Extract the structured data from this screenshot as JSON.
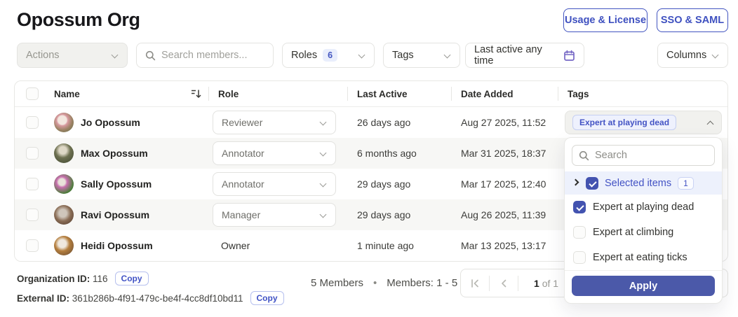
{
  "header": {
    "title": "Opossum Org",
    "usage_button": "Usage & License",
    "sso_button": "SSO & SAML"
  },
  "toolbar": {
    "actions_label": "Actions",
    "search_placeholder": "Search members...",
    "roles_label": "Roles",
    "roles_count": "6",
    "tags_label": "Tags",
    "last_active_label": "Last active any time",
    "columns_label": "Columns"
  },
  "table": {
    "columns": [
      "Name",
      "Role",
      "Last Active",
      "Date Added",
      "Tags"
    ],
    "rows": [
      {
        "name": "Jo Opossum",
        "role": "Reviewer",
        "last_active": "26 days ago",
        "date_added": "Aug 27 2025, 11:52",
        "tag": "Expert at playing dead"
      },
      {
        "name": "Max Opossum",
        "role": "Annotator",
        "last_active": "6 months ago",
        "date_added": "Mar 31 2025, 18:37",
        "tag": ""
      },
      {
        "name": "Sally Opossum",
        "role": "Annotator",
        "last_active": "29 days ago",
        "date_added": "Mar 17 2025, 12:40",
        "tag": ""
      },
      {
        "name": "Ravi Opossum",
        "role": "Manager",
        "last_active": "29 days ago",
        "date_added": "Aug 26 2025, 11:39",
        "tag": ""
      },
      {
        "name": "Heidi Opossum",
        "role": "Owner",
        "last_active": "1 minute ago",
        "date_added": "Mar 13 2025, 13:17",
        "tag": ""
      }
    ]
  },
  "tags_dropdown": {
    "search_placeholder": "Search",
    "selected_label": "Selected items",
    "selected_count": "1",
    "options": [
      {
        "label": "Expert at playing dead",
        "checked": true
      },
      {
        "label": "Expert at climbing",
        "checked": false
      },
      {
        "label": "Expert at eating ticks",
        "checked": false
      }
    ],
    "apply_label": "Apply"
  },
  "footer": {
    "org_id_label": "Organization ID:",
    "org_id": "116",
    "copy_label": "Copy",
    "external_id_label": "External ID:",
    "external_id": "361b286b-4f91-479c-be4f-4cc8df10bd11",
    "members_total": "5 Members",
    "dot": "•",
    "members_range": "Members: 1 - 5",
    "page_current": "1",
    "page_of": "of 1"
  },
  "colors": {
    "accent_text": "#4353c4",
    "accent_button": "#4b59a9",
    "checkbox_checked": "#4353b0",
    "pill_bg": "#eef1fd",
    "selected_row_bg": "#edf1fc",
    "row_stripe": "#f7f7f5",
    "calendar_icon": "#7668c5"
  }
}
